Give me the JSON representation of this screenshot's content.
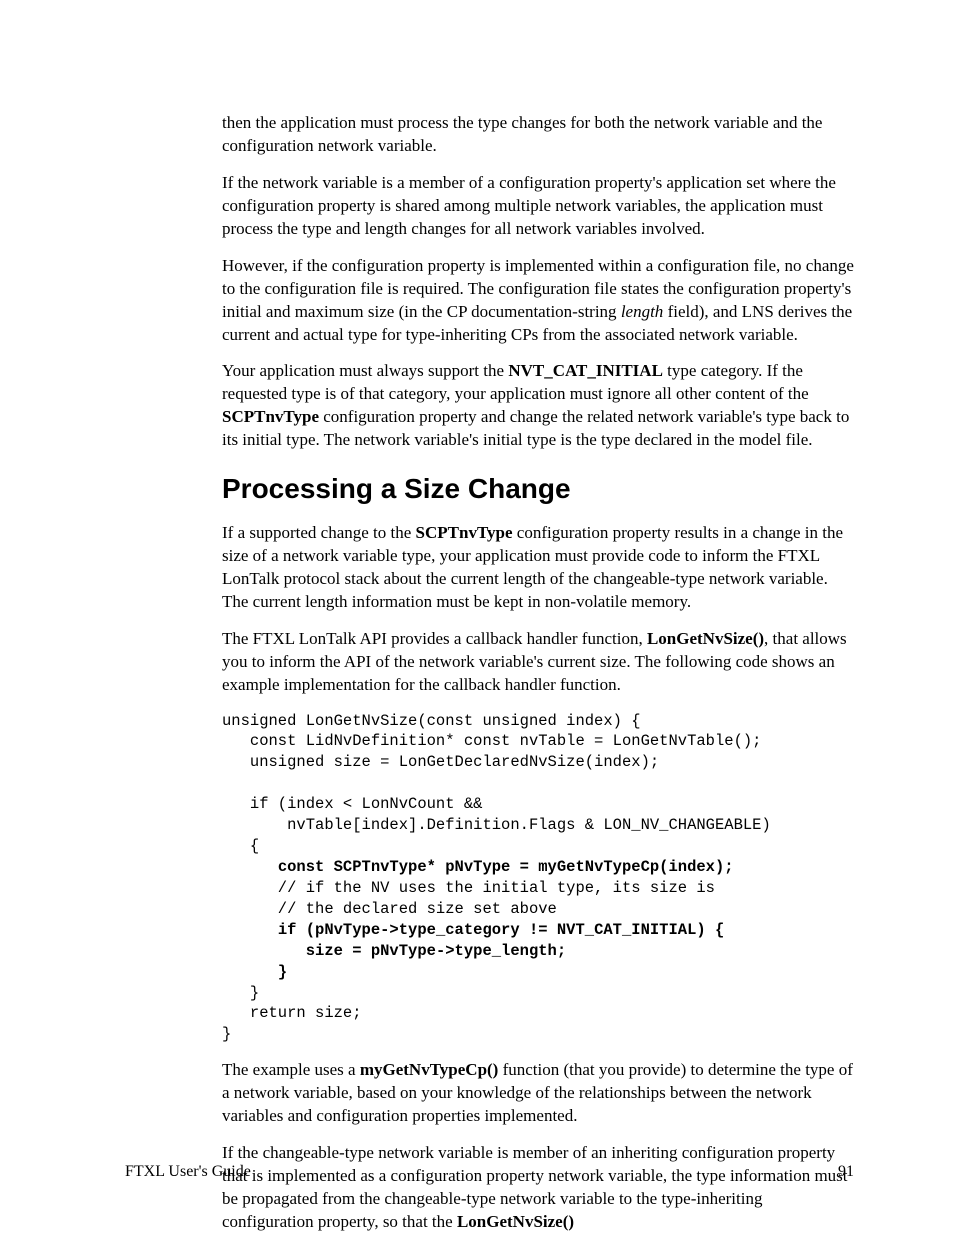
{
  "p1": "then the application must process the type changes for both the network variable and the configuration network variable.",
  "p2": "If the network variable is a member of a configuration property's application set where the configuration property is shared among multiple network variables, the application must process the type and length changes for all network variables involved.",
  "p3_a": "However, if the configuration property is implemented within a configuration file, no change to the configuration file is required.  The configuration file states the configuration property's initial and maximum size (in the CP documentation-string ",
  "p3_i": "length",
  "p3_b": " field), and LNS derives the current and actual type for type-inheriting CPs from the associated network variable.",
  "p4_a": "Your application must always support the ",
  "p4_b1": "NVT_CAT_INITIAL",
  "p4_b": " type category.  If the requested type is of that category, your application must ignore all other content of the ",
  "p4_b2": "SCPTnvType",
  "p4_c": " configuration property and change the related network variable's type back to its initial type.  The network variable's initial type is the type declared in the model file.",
  "h1": "Processing a Size Change",
  "p5_a": "If a supported change to the ",
  "p5_b1": "SCPTnvType",
  "p5_b": " configuration property results in a change in the size of a network variable type, your application must provide code to inform the FTXL LonTalk protocol stack about the current length of the changeable-type network variable.  The current length information must be kept in non-volatile memory.",
  "p6_a": "The FTXL LonTalk API provides a callback handler function, ",
  "p6_b1": "LonGetNvSize()",
  "p6_b": ", that allows you to inform the API of the network variable's current size.  The following code shows an example implementation for the callback handler function.",
  "code_l1": "unsigned LonGetNvSize(const unsigned index) { ",
  "code_l2": "   const LidNvDefinition* const nvTable = LonGetNvTable(); ",
  "code_l3": "   unsigned size = LonGetDeclaredNvSize(index); ",
  "code_l4": " ",
  "code_l5": "   if (index < LonNvCount && ",
  "code_l6": "       nvTable[index].Definition.Flags & LON_NV_CHANGEABLE) ",
  "code_l7": "   { ",
  "code_l8a": "      ",
  "code_l8b": "const SCPTnvType* pNvType = myGetNvTypeCp(index); ",
  "code_l9": "      // if the NV uses the initial type, its size is ",
  "code_l10": "      // the declared size set above ",
  "code_l11a": "      ",
  "code_l11b": "if (pNvType->type_category != NVT_CAT_INITIAL) { ",
  "code_l12a": "         ",
  "code_l12b": "size = pNvType->type_length; ",
  "code_l13a": "      ",
  "code_l13b": "} ",
  "code_l14": "   } ",
  "code_l15": "   return size; ",
  "code_l16": "} ",
  "p7_a": "The example uses a ",
  "p7_b1": "myGetNvTypeCp()",
  "p7_b": " function (that you provide) to determine the type of a network variable, based on your knowledge of the relationships between the network variables and configuration properties implemented.",
  "p8_a": "If the changeable-type network variable is member of an inheriting configuration property that is implemented as a configuration property network variable, the type information must be propagated from the changeable-type network variable to the type-inheriting configuration property, so that the ",
  "p8_b1": "LonGetNvSize()",
  "footer_left": "FTXL User's Guide",
  "footer_right": "91"
}
